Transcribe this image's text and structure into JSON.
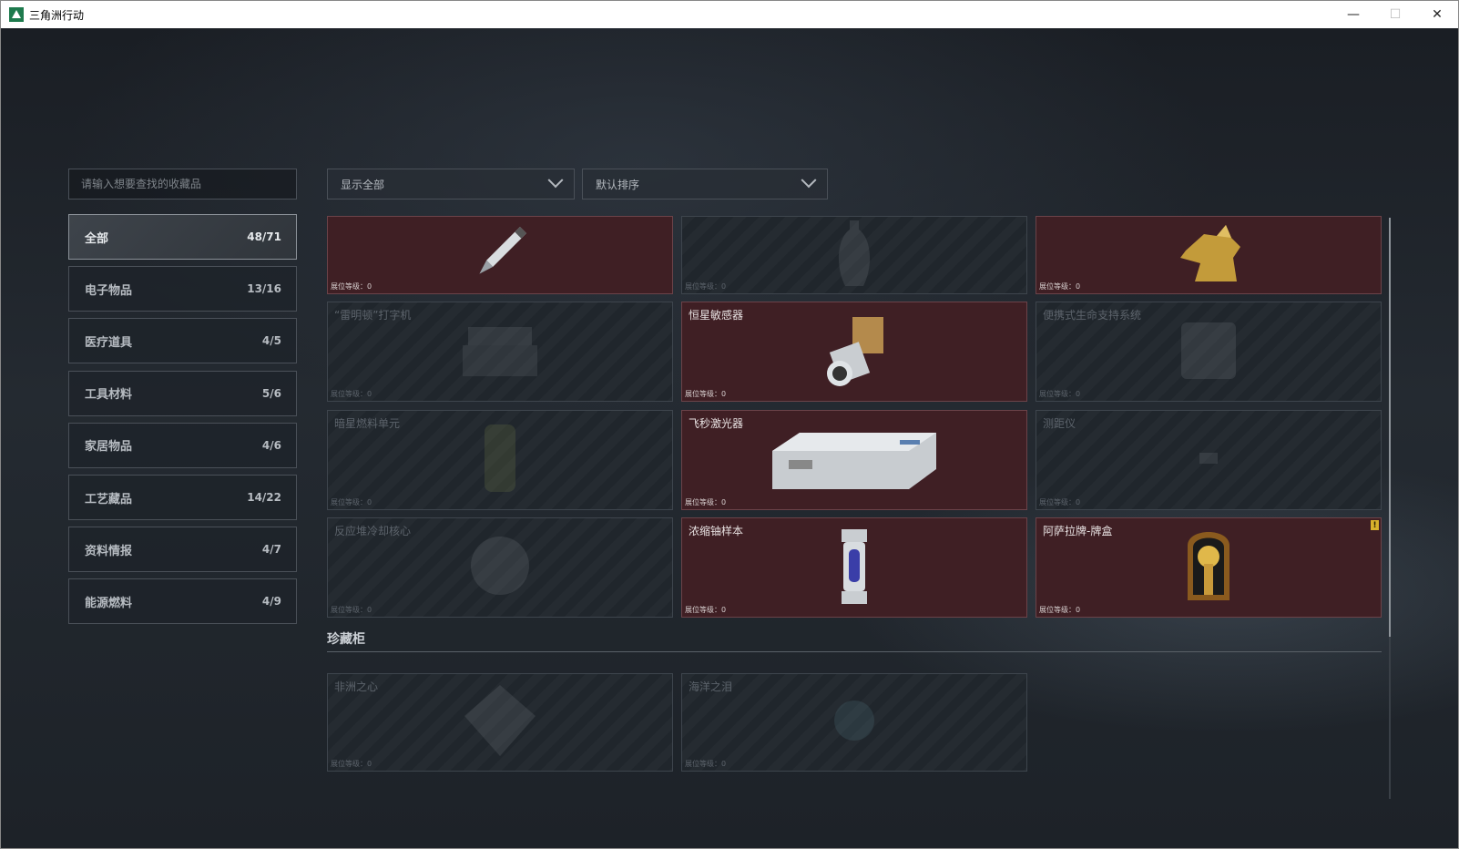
{
  "window": {
    "title": "三角洲行动"
  },
  "search": {
    "placeholder": "请输入想要查找的收藏品"
  },
  "filters": {
    "show": "显示全部",
    "sort": "默认排序"
  },
  "sidebar": {
    "items": [
      {
        "label": "全部",
        "count": "48/71",
        "active": true
      },
      {
        "label": "电子物品",
        "count": "13/16"
      },
      {
        "label": "医疗道具",
        "count": "4/5"
      },
      {
        "label": "工具材料",
        "count": "5/6"
      },
      {
        "label": "家居物品",
        "count": "4/6"
      },
      {
        "label": "工艺藏品",
        "count": "14/22"
      },
      {
        "label": "资料情报",
        "count": "4/7"
      },
      {
        "label": "能源燃料",
        "count": "4/9"
      }
    ]
  },
  "items": [
    {
      "name": "",
      "level": "展位等级：0",
      "owned": true,
      "icon": "pen-icon"
    },
    {
      "name": "",
      "level": "展位等级：0",
      "owned": false,
      "icon": "vase-icon"
    },
    {
      "name": "",
      "level": "展位等级：0",
      "owned": true,
      "icon": "golden-beast-icon"
    },
    {
      "name": "“雷明顿”打字机",
      "level": "展位等级：0",
      "owned": false,
      "icon": "typewriter-icon"
    },
    {
      "name": "恒星敏感器",
      "level": "展位等级：0",
      "owned": true,
      "icon": "star-sensor-icon"
    },
    {
      "name": "便携式生命支持系统",
      "level": "展位等级：0",
      "owned": false,
      "icon": "life-support-icon"
    },
    {
      "name": "暗星燃料单元",
      "level": "展位等级：0",
      "owned": false,
      "icon": "fuel-cell-icon"
    },
    {
      "name": "飞秒激光器",
      "level": "展位等级：0",
      "owned": true,
      "icon": "laser-icon"
    },
    {
      "name": "测距仪",
      "level": "展位等级：0",
      "owned": false,
      "icon": "rangefinder-icon"
    },
    {
      "name": "反应堆冷却核心",
      "level": "展位等级：0",
      "owned": false,
      "icon": "reactor-core-icon"
    },
    {
      "name": "浓缩铀样本",
      "level": "展位等级：0",
      "owned": true,
      "icon": "uranium-sample-icon"
    },
    {
      "name": "阿萨拉牌-牌盒",
      "level": "展位等级：0",
      "owned": true,
      "icon": "card-box-icon",
      "badge": "!"
    }
  ],
  "cabinet": {
    "title": "珍藏柜",
    "items": [
      {
        "name": "非洲之心",
        "level": "展位等级：0",
        "owned": false,
        "icon": "diamond-icon"
      },
      {
        "name": "海洋之泪",
        "level": "展位等级：0",
        "owned": false,
        "icon": "tear-gem-icon"
      }
    ]
  },
  "colors": {
    "owned_bg": "#3f1f24",
    "badge": "#d9b12b"
  }
}
